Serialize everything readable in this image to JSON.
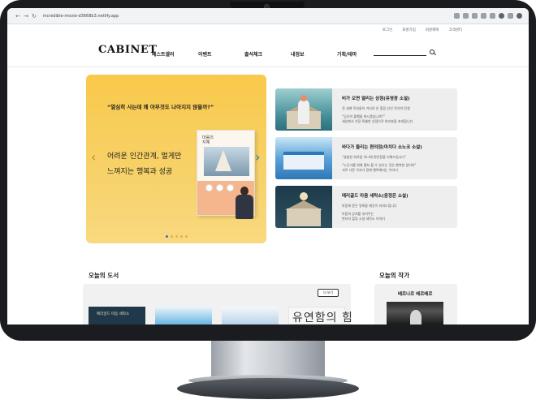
{
  "browser": {
    "url": "incredible-movie-d3668b3.netlify.app",
    "back": "←",
    "forward": "→",
    "reload": "↻"
  },
  "util_links": [
    "로그인",
    "회원가입",
    "회원혜택",
    "고객센터"
  ],
  "header": {
    "logo": "CABINET",
    "nav": [
      "베스트셀러",
      "이벤트",
      "출석체크",
      "내정보",
      "기획/테마"
    ]
  },
  "hero": {
    "quote": "“열심히 사는데 왜 아무것도 나아지지 않을까?”",
    "title_line1": "어려운 인간관계, 멀게만",
    "title_line2": "느껴지는 행복과 성공",
    "book_title": "마음의\n지혜",
    "slide_count": 5,
    "active_slide": 0
  },
  "cards": [
    {
      "title": "비가 오면 열리는 상점(유영광 소설)",
      "sub": "전 세계 독자들이 기다려 온 힐링 신인 작가의 탄생",
      "desc1": "“당신의 불행을 파시겠습니까?”",
      "desc2": "세상에서 가장 특별한 상점으로 여러분을 초대합니다"
    },
    {
      "title": "바다가 들리는 편의점(마치다 소노코 소설)",
      "sub": "“쓸쓸한 외로움 하나에 편안함을 더해드립니다”",
      "desc1": "“누군가를 위해 펼쳐 볼 수 있다는 것은 행복한 일이야”",
      "desc2": "서로 다른 각자가 함께 행복해지는 이야기"
    },
    {
      "title": "메리골드 마음 세탁소(윤정은 소설)",
      "sub": "마음에 묻은 얼룩을 깨끗이 지워드립니다",
      "desc1": "아픔의 상처를 씻어주는",
      "desc2": "판타지 힐링 소설 세탁소 이야기"
    }
  ],
  "today_books": {
    "section_title": "오늘의 도서",
    "more_label": "더 보기",
    "book1_title": "메리골드 마음 세탁소",
    "book4_title": "유연함의 힘"
  },
  "today_author": {
    "section_title": "오늘의 작가",
    "name": "베르나르 베르베르"
  }
}
